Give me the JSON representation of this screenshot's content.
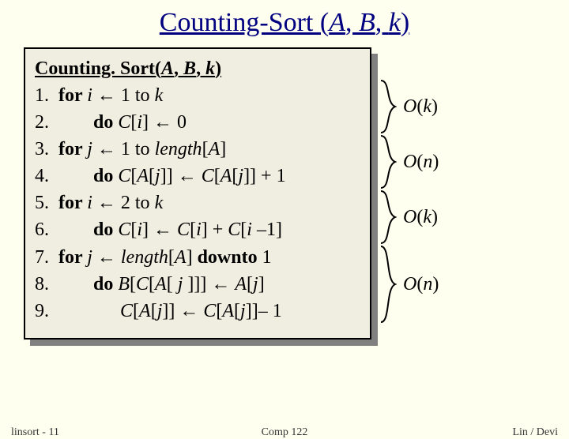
{
  "title": {
    "pre": "Counting-Sort (",
    "a": "A",
    "sep1": ", ",
    "b": "B",
    "sep2": ", ",
    "k": "k",
    "post": ")"
  },
  "head": {
    "pre": "Counting. Sort(",
    "a": "A",
    "sep1": ", ",
    "b": "B",
    "sep2": ", ",
    "k": "k",
    "post": ")"
  },
  "lines": {
    "l1": {
      "n": "1.",
      "t1": "for ",
      "i": "i ",
      "arr": "← 1 to ",
      "k": "k"
    },
    "l2": {
      "n": "2.",
      "t1": "do ",
      "ci": "C",
      "br": "[",
      "i": "i",
      "br2": "] ← 0"
    },
    "l3": {
      "n": "3.",
      "t1": "for ",
      "j": "j ",
      "arr": "← 1 to ",
      "len": "length",
      "brA": "[",
      "a": "A",
      "brA2": "]"
    },
    "l4": {
      "n": "4.",
      "t1": "do ",
      "c": "C",
      "b1": "[",
      "a1": "A",
      "b2": "[",
      "j": "j",
      "b3": "]] ← ",
      "c2": "C",
      "b4": "[",
      "a2": "A",
      "b5": "[",
      "j2": "j",
      "b6": "]] + 1"
    },
    "l5": {
      "n": "5.",
      "t1": "for ",
      "i": "i ",
      "arr": "← 2 to ",
      "k": "k"
    },
    "l6": {
      "n": "6.",
      "t1": "do ",
      "c": "C",
      "b1": "[",
      "i": "i",
      "b2": "] ← ",
      "c2": "C",
      "b3": "[",
      "i2": "i",
      "b4": "] + ",
      "c3": "C",
      "b5": "[",
      "i3": "i ",
      "m": "–1]"
    },
    "l7": {
      "n": "7.",
      "t1": "for ",
      "j": "j ",
      "arr": "← ",
      "len": "length",
      "b1": "[",
      "a": "A",
      "b2": "] ",
      "dt": "downto",
      "one": " 1"
    },
    "l8": {
      "n": "8.",
      "t1": "do ",
      "bC": "B",
      "b1": "[",
      "c": "C",
      "b2": "[",
      "a": "A",
      "b3": "[ ",
      "j": "j ",
      "b4": "]]] ← ",
      "a2": "A",
      "b5": "[",
      "j2": "j",
      "b6": "]"
    },
    "l9": {
      "n": "9.",
      "c": "C",
      "b1": "[",
      "a": "A",
      "b2": "[",
      "j": "j",
      "b3": "]] ← ",
      "c2": "C",
      "b4": "[",
      "a2": "A",
      "b5": "[",
      "j2": "j",
      "b6": "]]– 1"
    }
  },
  "bigO": {
    "o": "O",
    "k": "k",
    "n": "n",
    "lp": "(",
    "rp": ")"
  },
  "footer": {
    "left": "linsort - 11",
    "center": "Comp 122",
    "right": "Lin / Devi"
  }
}
